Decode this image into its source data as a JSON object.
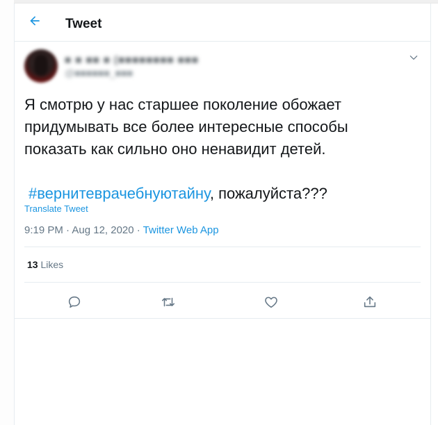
{
  "header": {
    "title": "Tweet",
    "back_icon": "arrow-left-icon"
  },
  "tweet": {
    "author_name": "■ ■ ■■ ■ (■■■■■■■■ ■■■",
    "author_handle": "@■■■■■■_■■■",
    "text_line1": "Я смотрю у нас старшее поколение обожает придумывать все более интересные способы показать как сильно оно ненавидит детей.",
    "hashtag": "#вернитеврачебнуютайну",
    "text_after_hashtag": ", пожалуйста???",
    "translate_label": "Translate Tweet",
    "timestamp": "9:19 PM · Aug 12, 2020 · ",
    "source_app": "Twitter Web App",
    "likes_count": "13",
    "likes_label": "Likes"
  },
  "actions": [
    {
      "icon": "reply-icon"
    },
    {
      "icon": "retweet-icon"
    },
    {
      "icon": "like-icon"
    },
    {
      "icon": "share-icon"
    }
  ],
  "colors": {
    "accent": "#1b95e0",
    "text": "#14171a",
    "muted": "#657786",
    "border": "#e6ecf0"
  }
}
